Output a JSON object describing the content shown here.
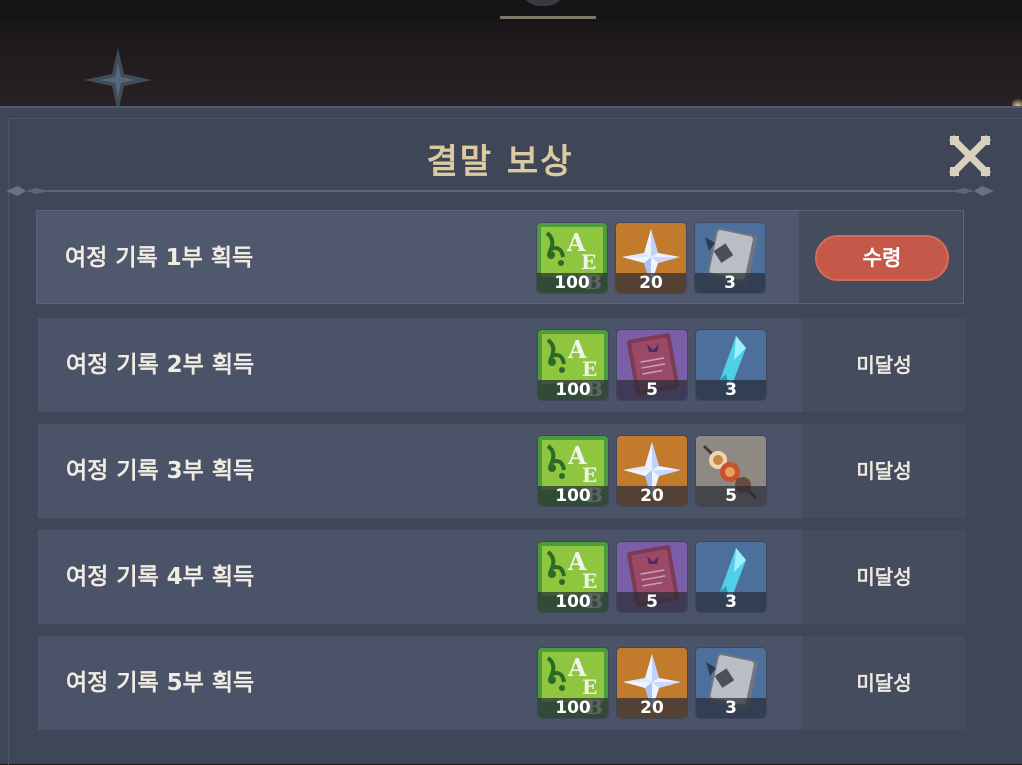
{
  "dialog": {
    "title": "결말 보상"
  },
  "rows": [
    {
      "label": "여정 기록 1부 획득",
      "status": "claimable",
      "action_label": "수령",
      "rewards": [
        {
          "icon": "exp-book-icon",
          "count": "100",
          "bg": "#3f8c3a"
        },
        {
          "icon": "primogem-icon",
          "count": "20",
          "bg": "#c17a2a"
        },
        {
          "icon": "wanderer-advice-book-icon",
          "count": "3",
          "bg": "#4a6c98"
        }
      ]
    },
    {
      "label": "여정 기록 2부 획득",
      "status": "incomplete",
      "action_label": "미달성",
      "rewards": [
        {
          "icon": "exp-book-icon",
          "count": "100",
          "bg": "#3f8c3a"
        },
        {
          "icon": "heros-wit-book-icon",
          "count": "5",
          "bg": "#7a5ca6"
        },
        {
          "icon": "enhancement-ore-crystal-icon",
          "count": "3",
          "bg": "#4a6c98"
        }
      ]
    },
    {
      "label": "여정 기록 3부 획득",
      "status": "incomplete",
      "action_label": "미달성",
      "rewards": [
        {
          "icon": "exp-book-icon",
          "count": "100",
          "bg": "#3f8c3a"
        },
        {
          "icon": "primogem-icon",
          "count": "20",
          "bg": "#c17a2a"
        },
        {
          "icon": "skewer-food-icon",
          "count": "5",
          "bg": "#8c8680"
        }
      ]
    },
    {
      "label": "여정 기록 4부 획득",
      "status": "incomplete",
      "action_label": "미달성",
      "rewards": [
        {
          "icon": "exp-book-icon",
          "count": "100",
          "bg": "#3f8c3a"
        },
        {
          "icon": "heros-wit-book-icon",
          "count": "5",
          "bg": "#7a5ca6"
        },
        {
          "icon": "enhancement-ore-crystal-icon",
          "count": "3",
          "bg": "#4a6c98"
        }
      ]
    },
    {
      "label": "여정 기록 5부 획득",
      "status": "incomplete",
      "action_label": "미달성",
      "rewards": [
        {
          "icon": "exp-book-icon",
          "count": "100",
          "bg": "#3f8c3a"
        },
        {
          "icon": "primogem-icon",
          "count": "20",
          "bg": "#c17a2a"
        },
        {
          "icon": "wanderer-advice-book-icon",
          "count": "3",
          "bg": "#4a6c98"
        }
      ]
    }
  ],
  "colors": {
    "title_gold": "#dccaa0",
    "claim_button": "#c4594a",
    "panel": "#3e4658",
    "row": "#4a5367"
  }
}
